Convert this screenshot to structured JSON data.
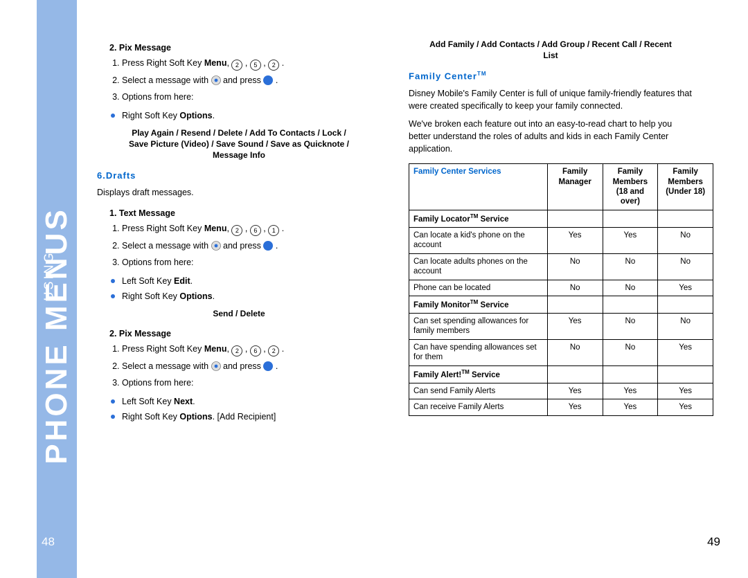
{
  "tab": {
    "small": "USING",
    "main": "PHONE MENUS"
  },
  "pages": {
    "left": "48",
    "right": "49"
  },
  "left": {
    "s1": {
      "title": "2. Pix Message",
      "step1_pre": "Press Right Soft Key ",
      "menu": "Menu",
      "comma": ", ",
      "k2": "2",
      "k5": "5",
      "step2a": "Select a message with ",
      "step2b": " and press ",
      "step3": "Options from here:",
      "bullet1a": "Right Soft Key ",
      "bullet1b": "Options",
      "bullet1c": ".",
      "centered": "Play Again / Resend / Delete / Add To Contacts / Lock / Save Picture (Video) / Save Sound / Save as Quicknote / Message Info"
    },
    "drafts": {
      "heading": "6.Drafts",
      "intro": "Displays draft messages.",
      "s2": {
        "title": "1. Text Message",
        "k2": "2",
        "k6": "6",
        "k1": "1",
        "bullet_edit_a": "Left Soft Key ",
        "bullet_edit_b": "Edit",
        "bullet_edit_c": ".",
        "bullet_opt_a": "Right Soft Key ",
        "bullet_opt_b": "Options",
        "bullet_opt_c": ".",
        "centered": "Send / Delete"
      },
      "s3": {
        "title": "2. Pix Message",
        "k2": "2",
        "k6": "6",
        "k2b": "2",
        "bullet_next_a": "Left Soft Key ",
        "bullet_next_b": "Next",
        "bullet_next_c": ".",
        "bullet_opt_a": "Right Soft Key ",
        "bullet_opt_b": "Options",
        "bullet_opt_c": ". [Add Recipient]"
      }
    }
  },
  "right": {
    "topline": "Add Family / Add Contacts / Add Group / Recent Call / Recent List",
    "fc_heading": "Family Center",
    "tm": "TM",
    "p1": "Disney Mobile's Family Center is full of unique family-friendly features that were created specifically to keep your family connected.",
    "p2": "We've broken each feature out into an easy-to-read chart to help you better understand the roles of adults and kids in each Family Center application.",
    "table": {
      "headers": {
        "services": "Family Center Services",
        "h2a": "Family",
        "h2b": "Manager",
        "h3a": "Family",
        "h3b": "Members",
        "h3c": "(18 and over)",
        "h4a": "Family",
        "h4b": "Members",
        "h4c": "(Under 18)"
      },
      "rows": [
        {
          "label_a": "Family Locator",
          "label_b": " Service",
          "sub": true,
          "c2": "",
          "c3": "",
          "c4": ""
        },
        {
          "label": "Can locate a kid's phone on the account",
          "c2": "Yes",
          "c3": "Yes",
          "c4": "No"
        },
        {
          "label": "Can locate adults phones on the account",
          "c2": "No",
          "c3": "No",
          "c4": "No"
        },
        {
          "label": "Phone can be located",
          "c2": "No",
          "c3": "No",
          "c4": "Yes"
        },
        {
          "label_a": "Family Monitor",
          "label_b": " Service",
          "sub": true,
          "c2": "",
          "c3": "",
          "c4": ""
        },
        {
          "label": "Can set spending allowances for family members",
          "c2": "Yes",
          "c3": "No",
          "c4": "No"
        },
        {
          "label": "Can have spending allowances set for them",
          "c2": "No",
          "c3": "No",
          "c4": "Yes"
        },
        {
          "label_a": "Family Alert!",
          "label_b": " Service",
          "sub": true,
          "c2": "",
          "c3": "",
          "c4": ""
        },
        {
          "label": "Can send Family Alerts",
          "c2": "Yes",
          "c3": "Yes",
          "c4": "Yes"
        },
        {
          "label": "Can receive Family Alerts",
          "c2": "Yes",
          "c3": "Yes",
          "c4": "Yes"
        }
      ]
    }
  }
}
